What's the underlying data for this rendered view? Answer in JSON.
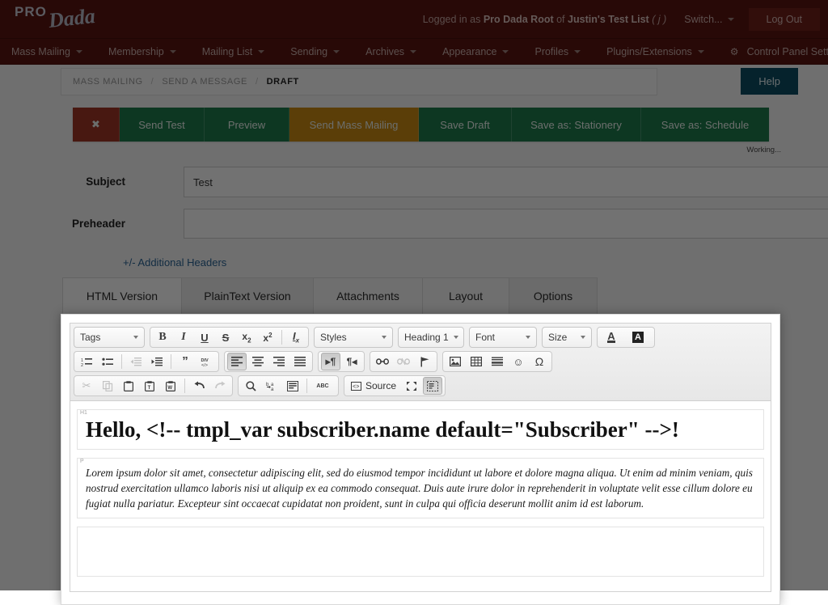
{
  "brand": {
    "logo_pro": "PRO",
    "logo_dada": "Dada",
    "header_bg": "#5a1410",
    "accent_green": "#1d7a4d",
    "accent_gold": "#c98a12",
    "accent_red": "#a03527",
    "help_blue": "#0d4c63"
  },
  "header": {
    "logged_in_prefix": "Logged in as",
    "logged_in_user": "Pro Dada Root",
    "logged_in_of": "of",
    "logged_in_list": "Justin's Test List",
    "logged_in_suffix": "( j )",
    "switch_label": "Switch...",
    "logout_label": "Log Out"
  },
  "nav": {
    "items": [
      {
        "label": "Mass Mailing",
        "caret": true
      },
      {
        "label": "Membership",
        "caret": true
      },
      {
        "label": "Mailing List",
        "caret": true
      },
      {
        "label": "Sending",
        "caret": true
      },
      {
        "label": "Archives",
        "caret": true
      },
      {
        "label": "Appearance",
        "caret": true
      },
      {
        "label": "Profiles",
        "caret": true
      },
      {
        "label": "Plugins/Extensions",
        "caret": true
      },
      {
        "label": "Control Panel Settings",
        "caret": true,
        "gear": "⚙"
      }
    ]
  },
  "breadcrumb": {
    "items": [
      "MASS MAILING",
      "SEND A MESSAGE",
      "DRAFT"
    ],
    "separator": "/",
    "active_index": 2
  },
  "help_button": {
    "label": "Help"
  },
  "actions": {
    "close_label": "✖",
    "buttons": [
      {
        "label": "Send Test",
        "style": "green",
        "width": 105
      },
      {
        "label": "Preview",
        "style": "green",
        "width": 105
      },
      {
        "label": "Send Mass Mailing",
        "style": "gold",
        "width": 160
      },
      {
        "label": "Save Draft",
        "style": "green",
        "width": 115
      },
      {
        "label": "Save as: Stationery",
        "style": "green",
        "width": 160
      },
      {
        "label": "Save as: Schedule",
        "style": "green",
        "width": 158
      }
    ]
  },
  "status": {
    "working": "Working..."
  },
  "form": {
    "subject": {
      "label": "Subject",
      "value": "Test",
      "placeholder": ""
    },
    "preheader": {
      "label": "Preheader",
      "value": "",
      "placeholder": ""
    },
    "additional_headers_link": "+/- Additional Headers"
  },
  "tabs": [
    {
      "label": "HTML Version",
      "state": "active",
      "width": 148
    },
    {
      "label": "PlainText Version",
      "state": "raised",
      "width": 164
    },
    {
      "label": "Attachments",
      "state": "normal",
      "width": 136
    },
    {
      "label": "Layout",
      "state": "normal",
      "width": 108
    },
    {
      "label": "Options",
      "state": "raised",
      "width": 110
    }
  ],
  "editor": {
    "toolbar": {
      "row1": {
        "tags_combo": "Tags",
        "format_buttons": [
          {
            "name": "bold-icon",
            "glyph": "B"
          },
          {
            "name": "italic-icon",
            "glyph": "I"
          },
          {
            "name": "underline-icon",
            "glyph": "U"
          },
          {
            "name": "strikethrough-icon",
            "glyph": "S"
          },
          {
            "name": "subscript-icon",
            "glyph": "x₂"
          },
          {
            "name": "superscript-icon",
            "glyph": "x²"
          },
          {
            "name": "remove-format-icon",
            "glyph": "Iₓ"
          }
        ],
        "styles_combo": "Styles",
        "heading_combo": "Heading 1",
        "font_combo": "Font",
        "size_combo": "Size",
        "text_color_label": "A",
        "bg_color_label": "A"
      },
      "row2": {
        "list_buttons": [
          "numbered-list-icon",
          "bulleted-list-icon",
          "decrease-indent-icon",
          "increase-indent-icon",
          "blockquote-icon",
          "create-div-icon"
        ],
        "align_buttons": [
          "align-left-icon",
          "align-center-icon",
          "align-right-icon",
          "align-justify-icon"
        ],
        "direction_buttons": [
          "ltr-icon",
          "rtl-icon"
        ],
        "link_buttons": [
          "link-icon",
          "unlink-icon",
          "anchor-icon"
        ],
        "insert_buttons": [
          "image-icon",
          "table-icon",
          "horizontal-rule-icon",
          "smiley-icon",
          "special-char-icon"
        ]
      },
      "row3": {
        "clipboard_buttons": [
          "cut-icon",
          "copy-icon",
          "paste-icon",
          "paste-text-icon",
          "paste-word-icon"
        ],
        "history_buttons": [
          "undo-icon",
          "redo-icon"
        ],
        "find_buttons": [
          "find-icon",
          "replace-icon",
          "select-all-icon"
        ],
        "spell_label": "ABC",
        "source_label": "Source",
        "maximize_icon": "maximize-icon",
        "blocks_icon": "show-blocks-icon"
      }
    },
    "content": {
      "h1_tag": "H1",
      "h1_text": "Hello, <!-- tmpl_var subscriber.name default=\"Subscriber\" -->!",
      "p_tag": "P",
      "p_text": "Lorem ipsum dolor sit amet, consectetur adipiscing elit, sed do eiusmod tempor incididunt ut labore et dolore magna aliqua. Ut enim ad minim veniam, quis nostrud exercitation ullamco laboris nisi ut aliquip ex ea commodo consequat. Duis aute irure dolor in reprehenderit in voluptate velit esse cillum dolore eu fugiat nulla pariatur. Excepteur sint occaecat cupidatat non proident, sunt in culpa qui officia deserunt mollit anim id est laborum."
    }
  }
}
